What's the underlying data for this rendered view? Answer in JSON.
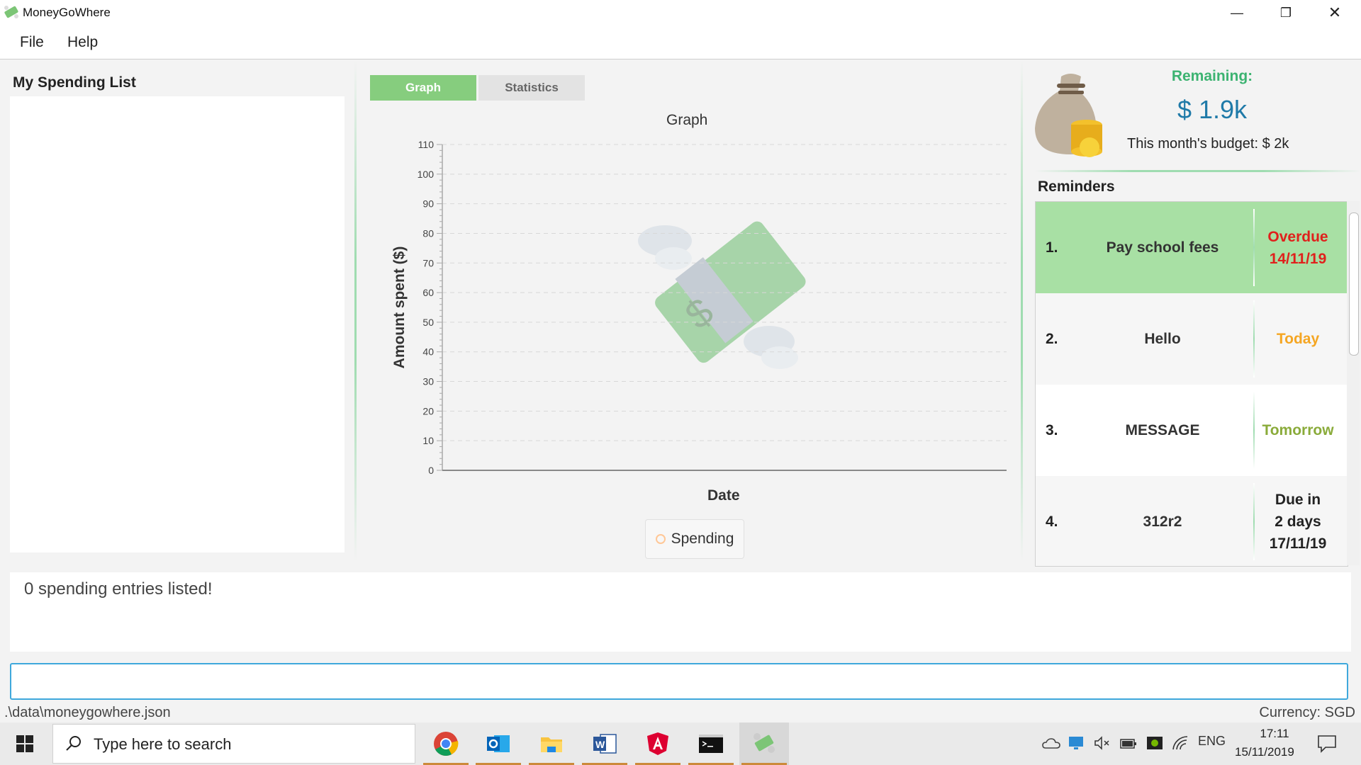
{
  "window": {
    "title": "MoneyGoWhere",
    "minimize_glyph": "—",
    "restore_glyph": "❐",
    "close_glyph": "✕"
  },
  "menu": {
    "file": "File",
    "help": "Help"
  },
  "spending_list": {
    "title": "My Spending List"
  },
  "tabs": {
    "graph": "Graph",
    "statistics": "Statistics"
  },
  "chart_data": {
    "type": "line",
    "title": "Graph",
    "xlabel": "Date",
    "ylabel": "Amount spent ($)",
    "ylim": [
      0,
      110
    ],
    "y_ticks": [
      "0",
      "10",
      "20",
      "30",
      "40",
      "50",
      "60",
      "70",
      "80",
      "90",
      "100",
      "110"
    ],
    "series": [
      {
        "name": "Spending",
        "values": []
      }
    ],
    "grid": true,
    "legend_placement": "bottom"
  },
  "budget": {
    "remaining_label": "Remaining:",
    "remaining_value": "$ 1.9k",
    "budget_label": "This month's budget: $ 2k"
  },
  "reminders": {
    "title": "Reminders",
    "items": [
      {
        "num": "1.",
        "message": "Pay school fees",
        "due": "Overdue\n14/11/19",
        "due_color": "#e0201c",
        "row_bg": "#a8e0a4"
      },
      {
        "num": "2.",
        "message": "Hello",
        "due": "Today",
        "due_color": "#f5a623",
        "row_bg": "#f6f6f6"
      },
      {
        "num": "3.",
        "message": "MESSAGE",
        "due": "Tomorrow",
        "due_color": "#8aab3a",
        "row_bg": "#ffffff"
      },
      {
        "num": "4.",
        "message": "312r2",
        "due": "Due in\n2 days\n17/11/19",
        "due_color": "#222222",
        "row_bg": "#f6f6f6"
      }
    ]
  },
  "result": {
    "text": "0 spending entries listed!"
  },
  "command": {
    "value": ""
  },
  "status": {
    "path": ".\\data\\moneygowhere.json",
    "currency": "Currency: SGD"
  },
  "taskbar": {
    "search_placeholder": "Type here to search",
    "tray_lang": "ENG",
    "clock_time": "17:11",
    "clock_date": "15/11/2019"
  },
  "colors": {
    "accent": "#86cd7e",
    "remaining": "#3cb371",
    "value": "#1f7aa8",
    "command_border": "#3fa8dc"
  }
}
